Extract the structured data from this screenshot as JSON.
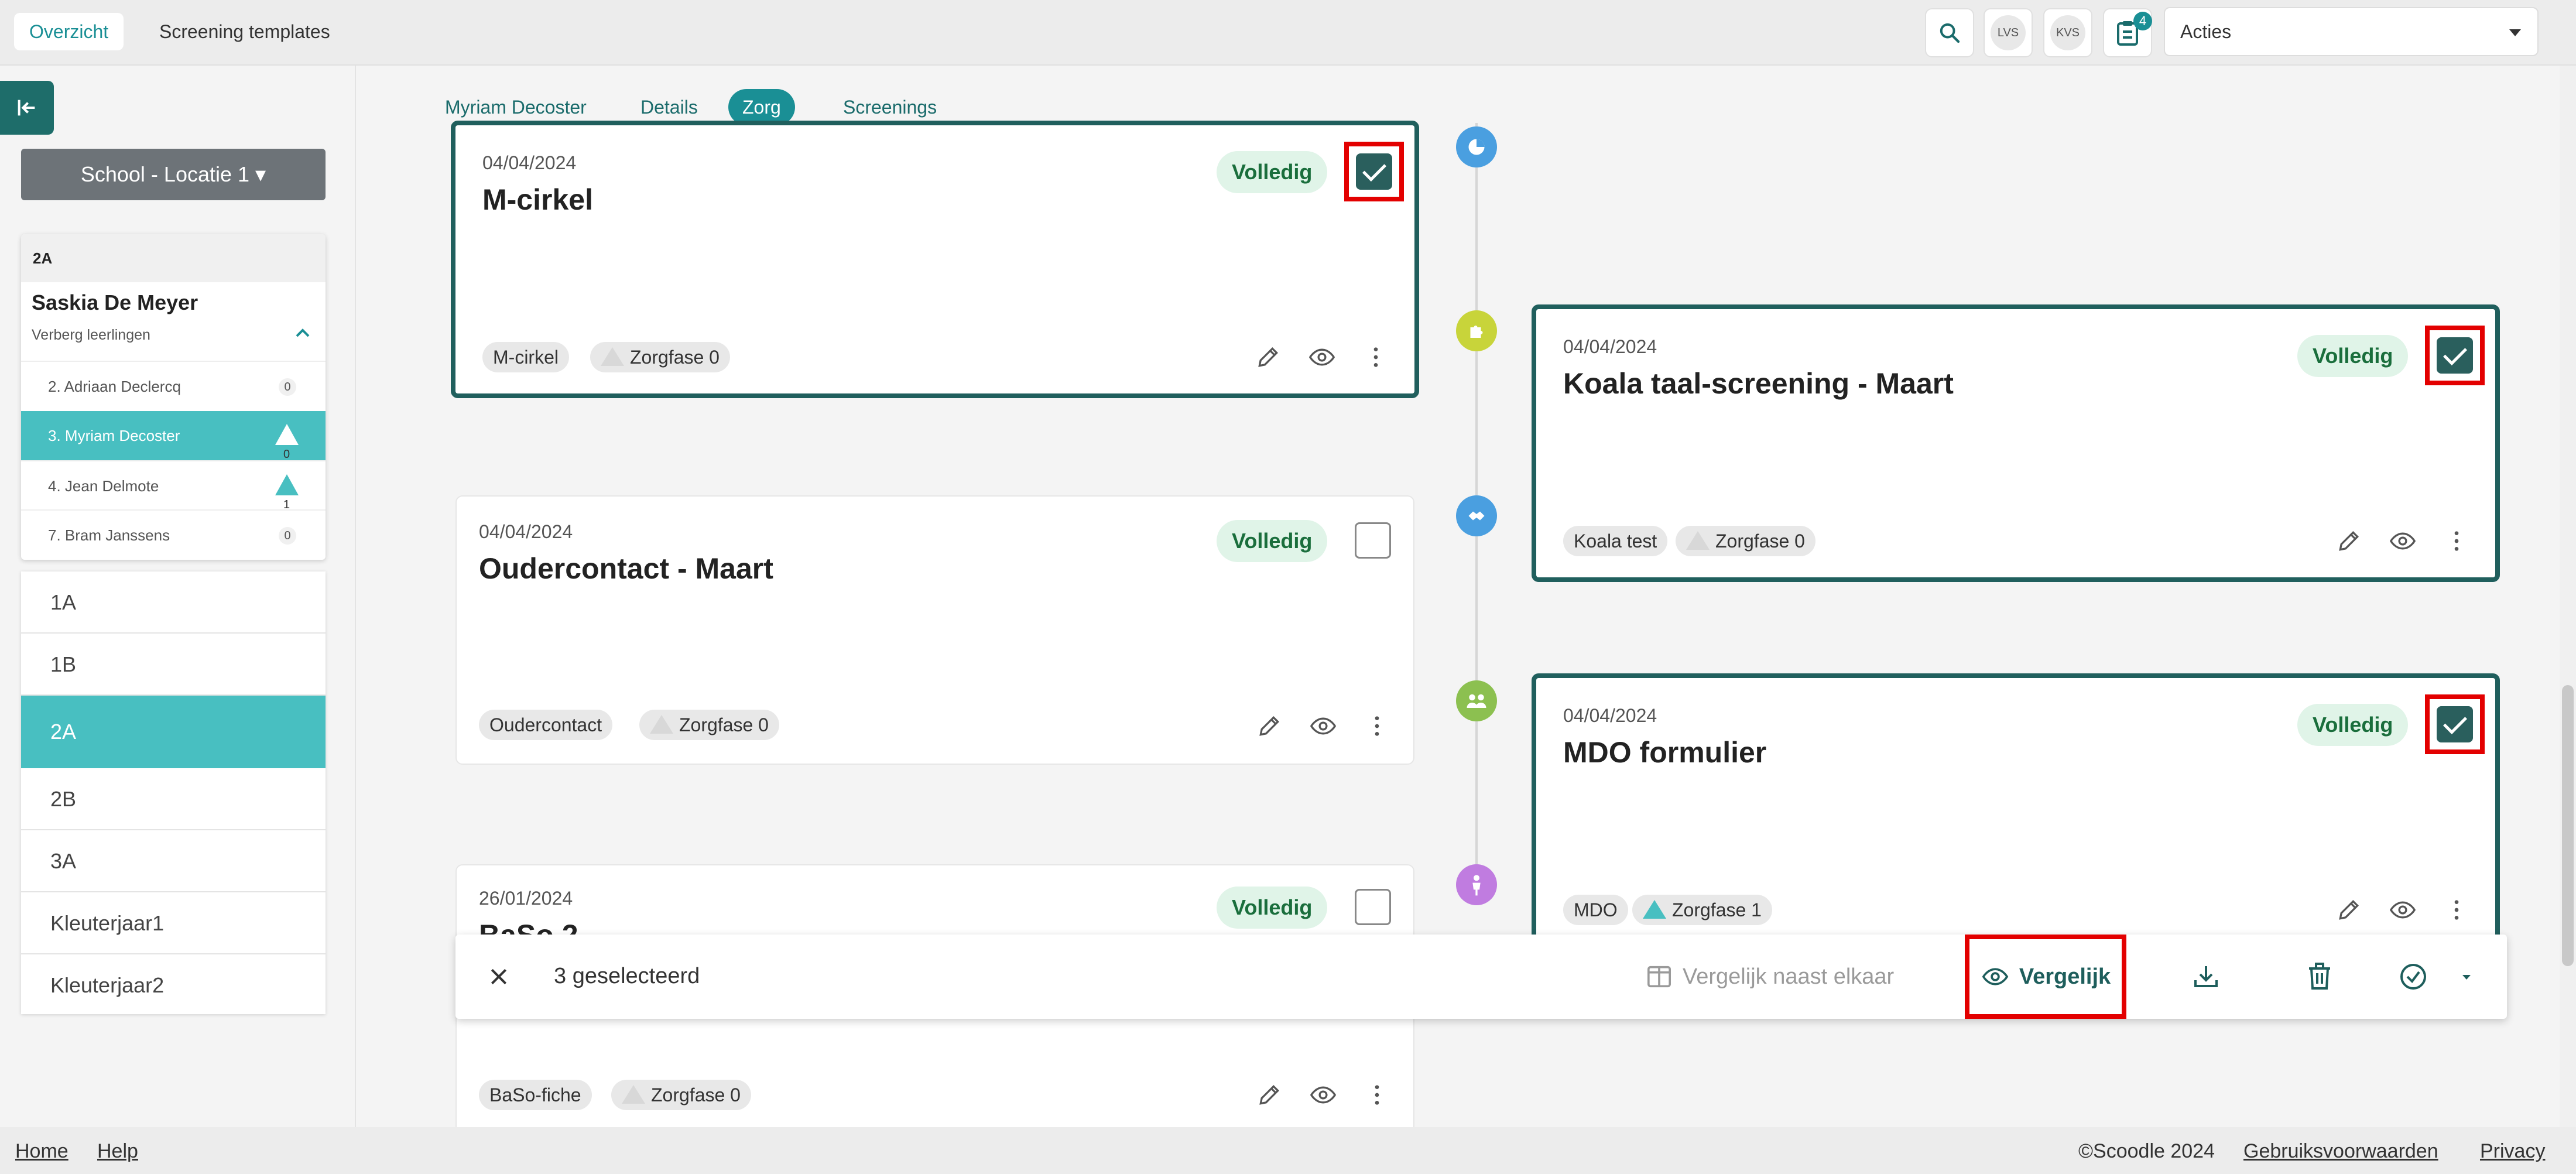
{
  "topbar": {
    "tabs": [
      {
        "label": "Overzicht",
        "active": true
      },
      {
        "label": "Screening templates",
        "active": false
      }
    ],
    "badges": [
      "LVS",
      "KVS"
    ],
    "notifications": "4",
    "actions_select": "Acties"
  },
  "sidebar": {
    "school_button": "School - Locatie 1",
    "class_header": "2A",
    "teacher": "Saskia De Meyer",
    "hide_students": "Verberg leerlingen",
    "students": [
      {
        "label": "2. Adriaan Declercq",
        "count": "0",
        "marker": "circle"
      },
      {
        "label": "3. Myriam Decoster",
        "count": "0",
        "marker": "triangle",
        "selected": true
      },
      {
        "label": "4. Jean Delmote",
        "count": "1",
        "marker": "triangle"
      },
      {
        "label": "7. Bram Janssens",
        "count": "0",
        "marker": "circle"
      }
    ],
    "classes": [
      "1A",
      "1B",
      "2A",
      "2B",
      "3A",
      "Kleuterjaar1",
      "Kleuterjaar2"
    ],
    "selected_class": "2A"
  },
  "content_tabs": [
    "Myriam Decoster",
    "Details",
    "Zorg",
    "Screenings"
  ],
  "active_content_tab": "Zorg",
  "cards": [
    {
      "date": "04/04/2024",
      "title": "M-cirkel",
      "status": "Volledig",
      "type": "M-cirkel",
      "phase": "Zorgfase 0",
      "checked": true
    },
    {
      "date": "04/04/2024",
      "title": "Koala taal-screening - Maart",
      "status": "Volledig",
      "type": "Koala test",
      "phase": "Zorgfase 0",
      "checked": true
    },
    {
      "date": "04/04/2024",
      "title": "Oudercontact - Maart",
      "status": "Volledig",
      "type": "Oudercontact",
      "phase": "Zorgfase 0",
      "checked": false
    },
    {
      "date": "04/04/2024",
      "title": "MDO formulier",
      "status": "Volledig",
      "type": "MDO",
      "phase": "Zorgfase 1",
      "checked": true
    },
    {
      "date": "26/01/2024",
      "title": "BaSo 2",
      "status": "Volledig",
      "type": "BaSo-fiche",
      "phase": "Zorgfase 0",
      "checked": false
    }
  ],
  "actionbar": {
    "selected_count": "3 geselecteerd",
    "compare_side": "Vergelijk naast elkaar",
    "compare": "Vergelijk"
  },
  "footer": {
    "home": "Home",
    "help": "Help",
    "copyright": "©Scoodle 2024",
    "terms": "Gebruiksvoorwaarden",
    "privacy": "Privacy"
  },
  "colors": {
    "accent": "#1a8f95",
    "selected_border": "#205f5d",
    "highlight": "#e30000",
    "status_bg": "#e0f4e8"
  }
}
